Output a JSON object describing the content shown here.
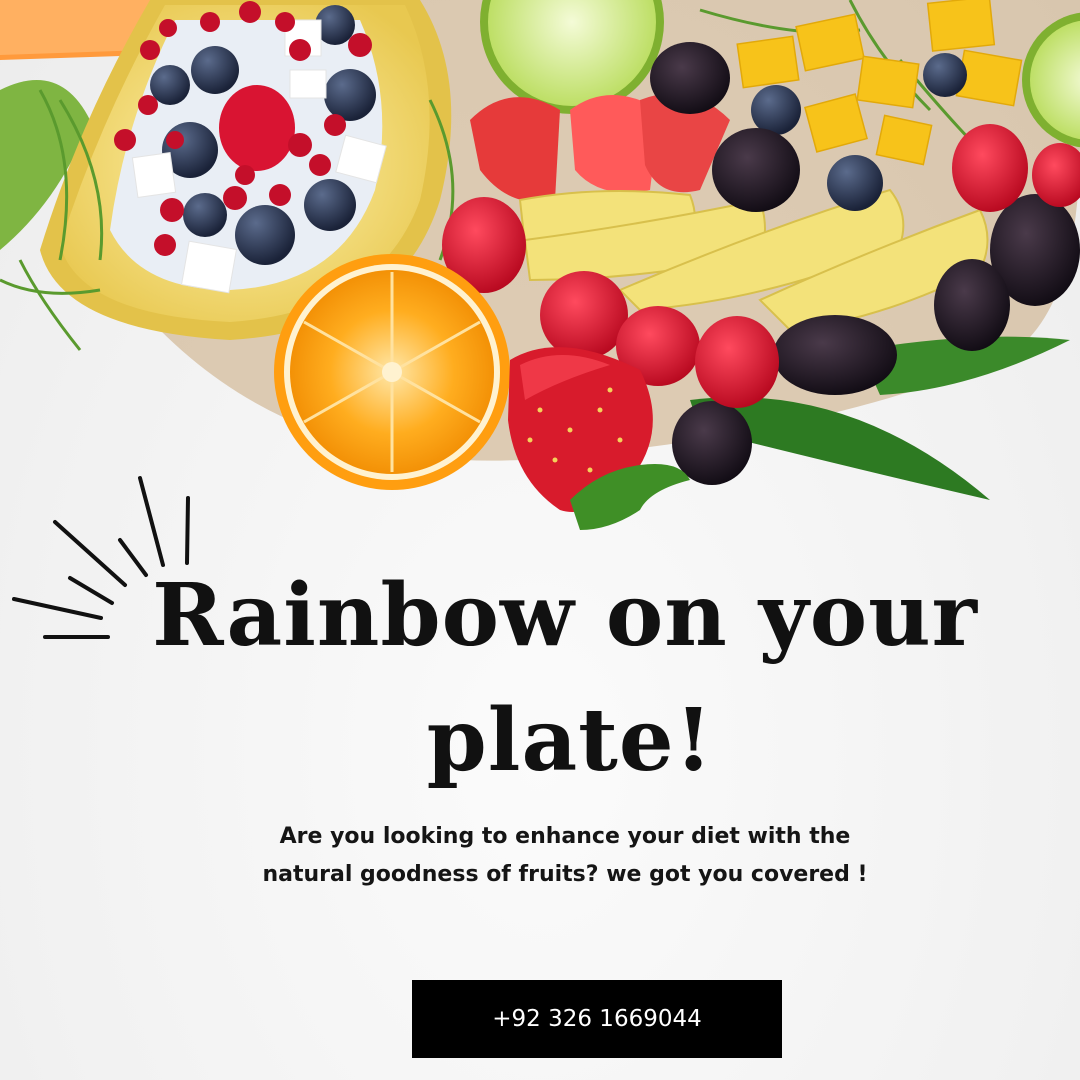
{
  "headline": {
    "line1": "Rainbow on your",
    "line2": "plate!"
  },
  "body": {
    "line1": "Are you looking to enhance your diet with the",
    "line2": "natural goodness of fruits? we got you covered !"
  },
  "cta": {
    "phone": "+92 326 1669044"
  },
  "decor": {
    "burst_icon": "sunburst-lines-icon",
    "photo": "fruit-platter-image"
  },
  "colors": {
    "background": "#f4f4f4",
    "text": "#111111",
    "button_bg": "#000000",
    "button_text": "#ffffff"
  }
}
